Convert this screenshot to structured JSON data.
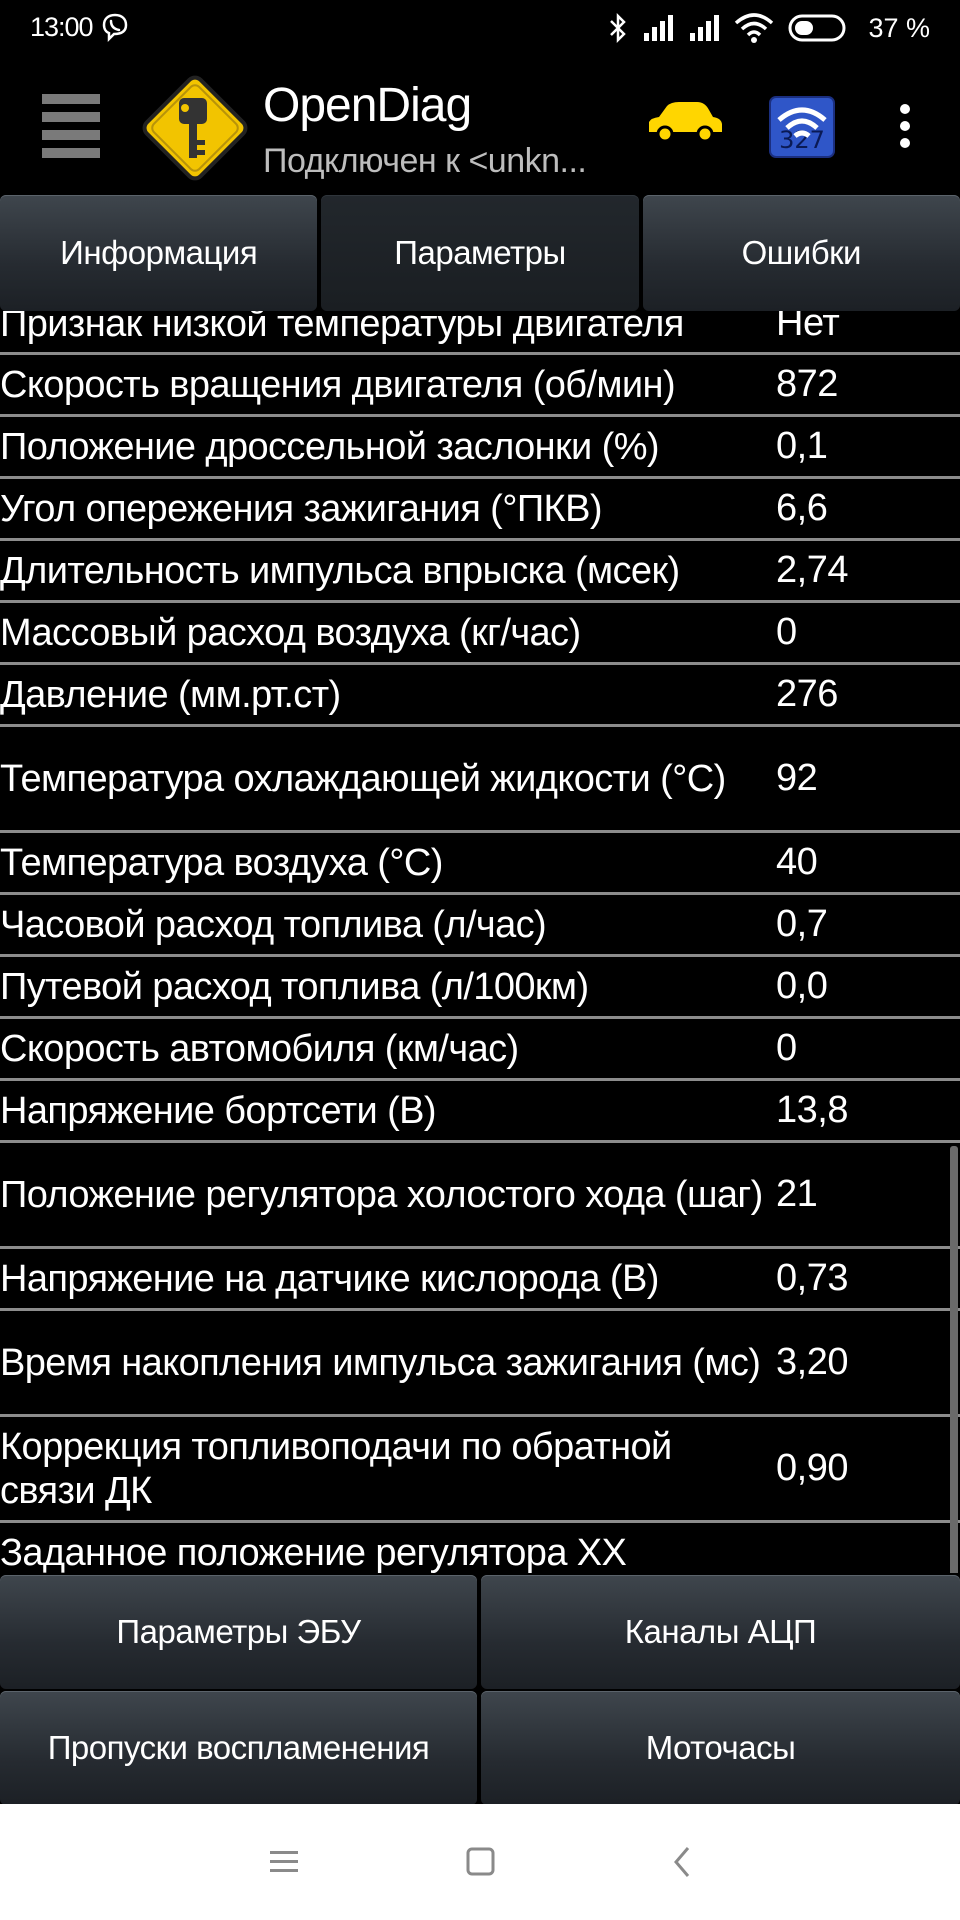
{
  "status_bar": {
    "time": "13:00",
    "battery_text": "37 %",
    "icons": [
      "viber-icon",
      "bluetooth-icon",
      "signal-icon",
      "signal-icon",
      "wifi-icon",
      "battery-icon"
    ]
  },
  "app_bar": {
    "title": "OpenDiag",
    "subtitle": "Подключен к <unkn...",
    "icons": [
      "menu-icon",
      "app-logo-key",
      "car-icon",
      "elm327-wifi-icon",
      "overflow-menu-icon"
    ],
    "colors": {
      "logo_yellow": "#f2c400",
      "car_yellow": "#ffd600",
      "conn_blue": "#2f56c8"
    }
  },
  "tabs": [
    {
      "label": "Информация",
      "active": false
    },
    {
      "label": "Параметры",
      "active": true
    },
    {
      "label": "Ошибки",
      "active": false
    }
  ],
  "parameters": [
    {
      "name": "Признак низкой температуры двигателя",
      "value": "Нет"
    },
    {
      "name": "Скорость вращения двигателя (об/мин)",
      "value": "872"
    },
    {
      "name": "Положение дроссельной заслонки (%)",
      "value": "0,1"
    },
    {
      "name": "Угол опережения зажигания (°ПКВ)",
      "value": "6,6"
    },
    {
      "name": "Длительность импульса впрыска (мсек)",
      "value": "2,74"
    },
    {
      "name": "Массовый расход воздуха (кг/час)",
      "value": "0"
    },
    {
      "name": "Давление (мм.рт.ст)",
      "value": "276"
    },
    {
      "name": "Температура охлаждающей жидкости (°С)",
      "value": "92"
    },
    {
      "name": "Температура воздуха (°С)",
      "value": "40"
    },
    {
      "name": "Часовой расход топлива (л/час)",
      "value": "0,7"
    },
    {
      "name": "Путевой расход топлива (л/100км)",
      "value": "0,0"
    },
    {
      "name": "Скорость автомобиля (км/час)",
      "value": "0"
    },
    {
      "name": "Напряжение бортсети (В)",
      "value": "13,8"
    },
    {
      "name": "Положение регулятора холостого хода (шаг)",
      "value": "21"
    },
    {
      "name": "Напряжение на датчике кислорода (В)",
      "value": "0,73"
    },
    {
      "name": "Время накопления импульса зажигания (мс)",
      "value": "3,20"
    },
    {
      "name": "Коррекция топливоподачи по обратной связи ДК",
      "value": "0,90"
    },
    {
      "name": "Заданное положение регулятора ХХ",
      "value": ""
    }
  ],
  "bottom_buttons": [
    {
      "label": "Параметры ЭБУ"
    },
    {
      "label": "Каналы АЦП"
    },
    {
      "label": "Пропуски воспламенения"
    },
    {
      "label": "Моточасы"
    }
  ],
  "nav_bar": {
    "icons": [
      "recents-icon",
      "home-icon",
      "back-icon"
    ]
  }
}
